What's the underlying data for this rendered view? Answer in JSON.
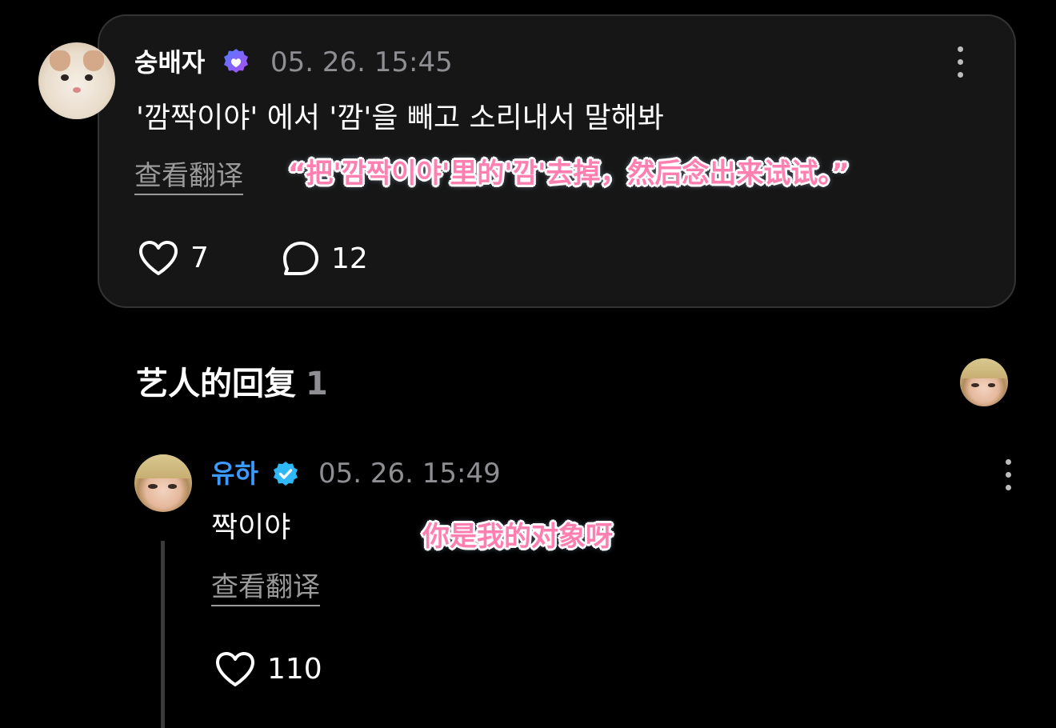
{
  "post": {
    "username": "숭배자",
    "timestamp": "05. 26. 15:45",
    "text": "'깜짝이야' 에서 '깜'을 빼고 소리내서 말해봐",
    "translate_label": "查看翻译",
    "caption": "“把'깜짝이야'里的'깜'去掉，然后念出来试试。”",
    "likes": "7",
    "comments": "12",
    "verified_color": "#7b5cf5"
  },
  "replies": {
    "title": "艺人的回复",
    "count": "1"
  },
  "reply": {
    "username": "유하",
    "timestamp": "05. 26. 15:49",
    "text": "짝이야",
    "translate_label": "查看翻译",
    "caption": "你是我的对象呀",
    "likes": "110",
    "username_color": "#3b9bff",
    "verified_color": "#2fb8f5"
  }
}
